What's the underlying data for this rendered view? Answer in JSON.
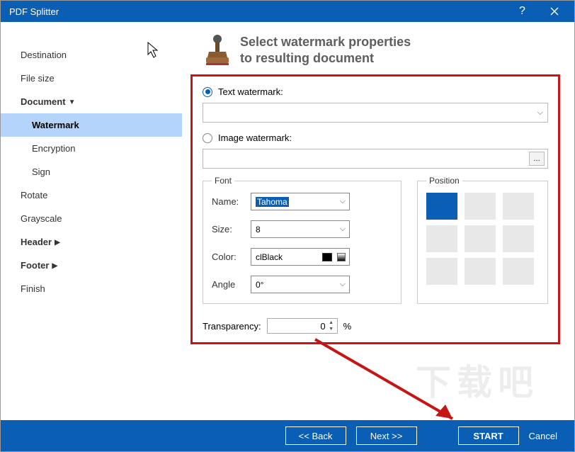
{
  "titlebar": {
    "title": "PDF Splitter"
  },
  "sidebar": {
    "items": [
      {
        "label": "Destination",
        "type": "item"
      },
      {
        "label": "File size",
        "type": "item"
      },
      {
        "label": "Document",
        "type": "parent-down"
      },
      {
        "label": "Watermark",
        "type": "child-selected"
      },
      {
        "label": "Encryption",
        "type": "child"
      },
      {
        "label": "Sign",
        "type": "child"
      },
      {
        "label": "Rotate",
        "type": "item"
      },
      {
        "label": "Grayscale",
        "type": "item"
      },
      {
        "label": "Header",
        "type": "parent-right"
      },
      {
        "label": "Footer",
        "type": "parent-right"
      },
      {
        "label": "Finish",
        "type": "item"
      }
    ]
  },
  "header": {
    "line1": "Select watermark properties",
    "line2": "to resulting document"
  },
  "panel": {
    "text_watermark_label": "Text watermark:",
    "image_watermark_label": "Image watermark:",
    "text_watermark_value": "",
    "image_watermark_value": "",
    "font_legend": "Font",
    "position_legend": "Position",
    "name_label": "Name:",
    "name_value": "Tahoma",
    "size_label": "Size:",
    "size_value": "8",
    "color_label": "Color:",
    "color_value": "clBlack",
    "angle_label": "Angle",
    "angle_value": "0°",
    "transparency_label": "Transparency:",
    "transparency_value": "0",
    "transparency_unit": "%",
    "position_selected": 0
  },
  "buttons": {
    "back": "<<  Back",
    "next": "Next  >>",
    "start": "START",
    "cancel": "Cancel"
  }
}
